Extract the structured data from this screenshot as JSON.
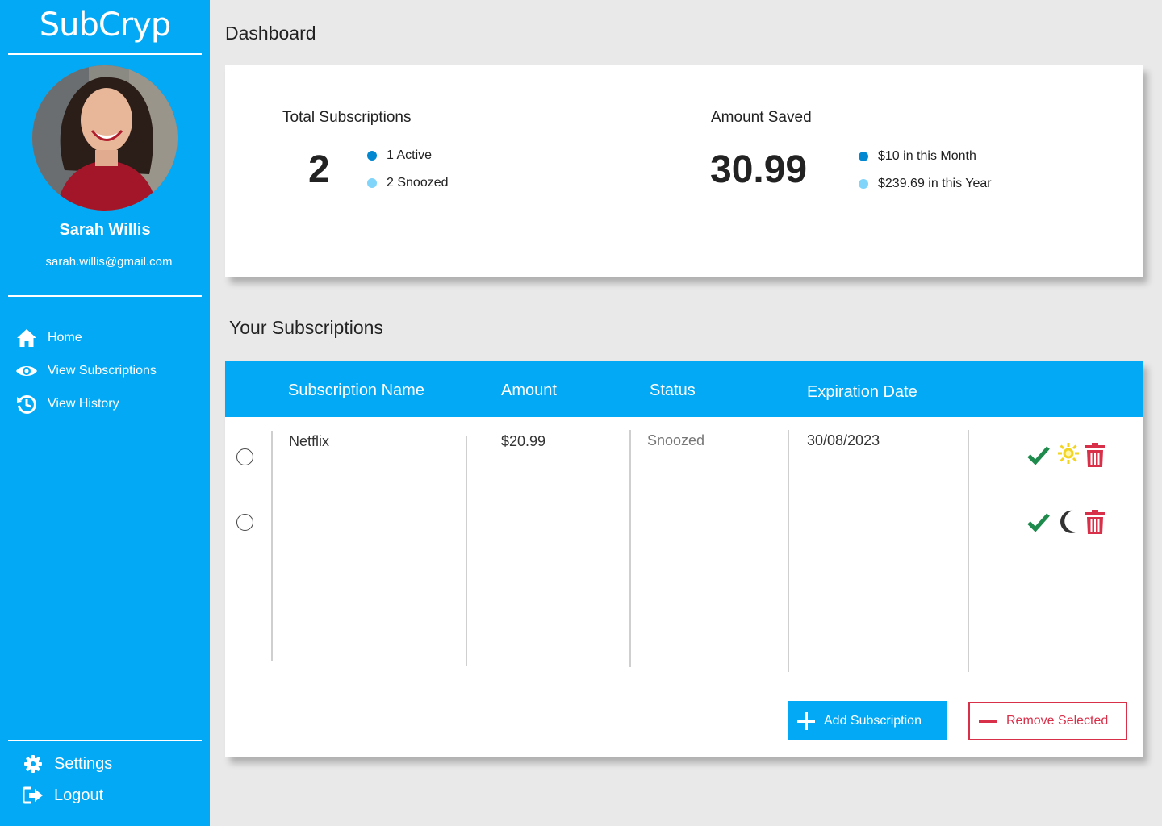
{
  "app": {
    "brand": "SubCryp"
  },
  "user": {
    "name": "Sarah Willis",
    "email": "sarah.willis@gmail.com"
  },
  "nav": {
    "items": [
      {
        "label": "Home",
        "icon": "home-icon"
      },
      {
        "label": "View Subscriptions",
        "icon": "eye-icon"
      },
      {
        "label": "View History",
        "icon": "history-icon"
      }
    ],
    "bottom": [
      {
        "label": "Settings",
        "icon": "gear-icon"
      },
      {
        "label": "Logout",
        "icon": "logout-icon"
      }
    ]
  },
  "dashboard": {
    "title": "Dashboard",
    "total": {
      "title": "Total Subscriptions",
      "value": "2",
      "legend": [
        {
          "label": "1 Active",
          "color": "#0288d1"
        },
        {
          "label": "2 Snoozed",
          "color": "#81d4fa"
        }
      ]
    },
    "saved": {
      "title": "Amount Saved",
      "value": "30.99",
      "legend": [
        {
          "label": "$10 in this Month",
          "color": "#0288d1"
        },
        {
          "label": "$239.69 in this Year",
          "color": "#81d4fa"
        }
      ]
    }
  },
  "subscriptions": {
    "title": "Your Subscriptions",
    "columns": [
      "Subscription Name",
      "Amount",
      "Status",
      "Expiration Date"
    ],
    "rows": [
      {
        "name": "Netflix",
        "amount": "$20.99",
        "status": "Snoozed",
        "expiration": "30/08/2023",
        "snooze_icon": "sun-icon"
      },
      {
        "name": "",
        "amount": "",
        "status": "",
        "expiration": "",
        "snooze_icon": "moon-icon"
      }
    ],
    "add_label": "Add Subscription",
    "remove_label": "Remove Selected"
  },
  "colors": {
    "accent": "#03a9f4",
    "danger": "#d9304a",
    "success": "#1e8a4c",
    "sun": "#f2d422"
  }
}
